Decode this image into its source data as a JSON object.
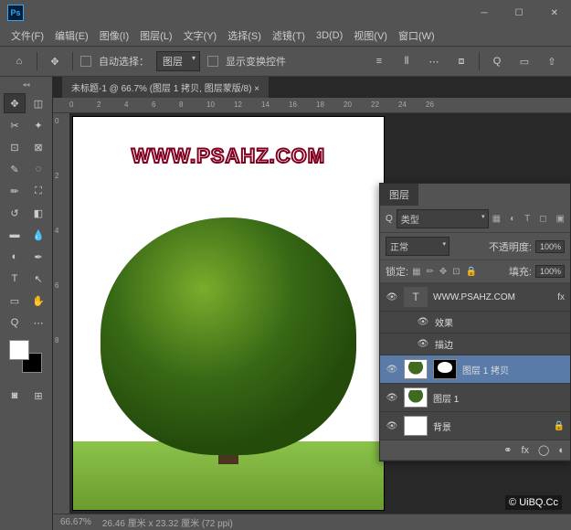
{
  "logo": "Ps",
  "menu": [
    "文件(F)",
    "编辑(E)",
    "图像(I)",
    "图层(L)",
    "文字(Y)",
    "选择(S)",
    "滤镜(T)",
    "3D(D)",
    "视图(V)",
    "窗口(W)"
  ],
  "options": {
    "autoSelect": "自动选择：",
    "autoSelectTarget": "图层",
    "showTransform": "显示变换控件"
  },
  "document": {
    "tab": "未标题-1 @ 66.7% (图层 1 拷贝, 图层蒙版/8) ×",
    "zoom": "66.67%",
    "dims": "26.46 厘米 x 23.32 厘米 (72 ppi)",
    "watermark": "WWW.PSAHZ.COM",
    "credit": "© UiBQ.Cc"
  },
  "rulerH": [
    "0",
    "2",
    "4",
    "6",
    "8",
    "10",
    "12",
    "14",
    "16",
    "18",
    "20",
    "22",
    "24",
    "26"
  ],
  "rulerV": [
    "0",
    "2",
    "4",
    "6",
    "8"
  ],
  "layersPanel": {
    "title": "图层",
    "filterLabel": "类型",
    "blend": "正常",
    "opacityLabel": "不透明度:",
    "opacityValue": "100%",
    "lockLabel": "锁定:",
    "fillLabel": "填充:",
    "fillValue": "100%",
    "layers": [
      {
        "name": "WWW.PSAHZ.COM",
        "type": "text",
        "fx": "fx",
        "visible": true
      },
      {
        "name": "效果",
        "type": "fx-group",
        "visible": true
      },
      {
        "name": "描边",
        "type": "fx-item",
        "visible": true
      },
      {
        "name": "图层 1 拷贝",
        "type": "mask",
        "visible": true,
        "active": true
      },
      {
        "name": "图层 1",
        "type": "tree",
        "visible": true
      },
      {
        "name": "背景",
        "type": "bg",
        "visible": true,
        "locked": true
      }
    ]
  }
}
